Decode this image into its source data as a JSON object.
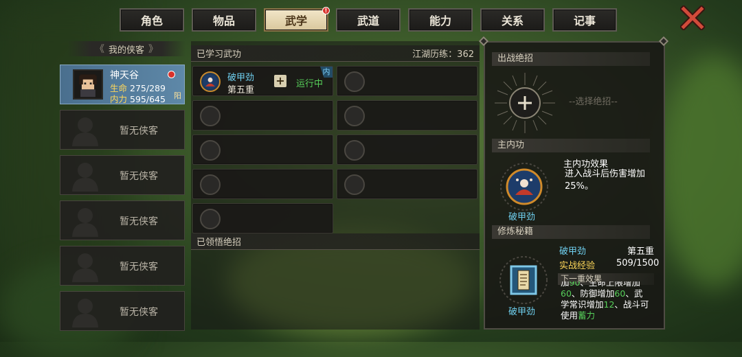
{
  "tabs": [
    {
      "label": "角色",
      "active": false
    },
    {
      "label": "物品",
      "active": false
    },
    {
      "label": "武学",
      "active": true,
      "badge": "!"
    },
    {
      "label": "武道",
      "active": false
    },
    {
      "label": "能力",
      "active": false
    },
    {
      "label": "关系",
      "active": false
    },
    {
      "label": "记事",
      "active": false
    }
  ],
  "left_panel": {
    "title": "我的侠客",
    "hero": {
      "name": "神天谷",
      "hp_label": "生命",
      "hp_value": "275/289",
      "mp_label": "内力",
      "mp_value": "595/645",
      "tag": "阳"
    },
    "empty_label": "暂无侠客"
  },
  "learned": {
    "title": "已学习武功",
    "exp_label": "江湖历练：362",
    "skill": {
      "name": "破甲劲",
      "level": "第五重",
      "status": "运行中",
      "type_tag": "内"
    }
  },
  "comprehended": {
    "title": "已领悟绝招"
  },
  "right_panel": {
    "battle_title": "出战绝招",
    "select_hint": "--选择绝招--",
    "main_title": "主内功",
    "effect_title": "主内功效果",
    "effect_desc": "进入战斗后伤害增加25%。",
    "main_skill_label": "破甲劲",
    "train_title": "修炼秘籍",
    "train_skill": "破甲劲",
    "train_level": "第五重",
    "exp_key": "实战经验",
    "exp_value": "509/1500",
    "next_title": "下一重效果",
    "next_line1_a": "加",
    "next_line1_b": "90",
    "next_line1_c": "、生命上限增加",
    "next_line2_a": "60",
    "next_line2_b": "、防御增加",
    "next_line2_c": "60",
    "next_line2_d": "、武",
    "next_line3_a": "学常识增加",
    "next_line3_b": "12",
    "next_line3_c": "、战斗可",
    "next_line4_a": "使用",
    "next_line4_b": "蓄力",
    "book_label": "破甲劲"
  },
  "colors": {
    "accent_cyan": "#6fd0f0",
    "green": "#57d05a",
    "active_tab": "#e8d9b2",
    "close_red": "#d14b3a"
  }
}
